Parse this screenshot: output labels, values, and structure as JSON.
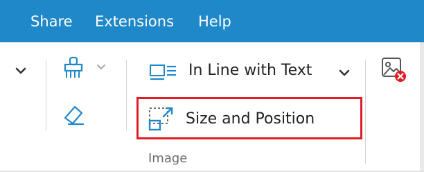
{
  "menubar": {
    "items": [
      "Share",
      "Extensions",
      "Help"
    ]
  },
  "ribbon": {
    "wrap_text_label": "In Line with Text",
    "size_position_label": "Size and Position",
    "group_label": "Image"
  },
  "colors": {
    "menubar_bg": "#1f88c9",
    "highlight": "#e11c24",
    "icon_blue": "#1f88c9"
  },
  "icons": [
    "chevron-down-icon",
    "paint-bucket-icon",
    "eraser-icon",
    "wrap-text-inline-icon",
    "size-position-icon",
    "image-remove-icon"
  ]
}
